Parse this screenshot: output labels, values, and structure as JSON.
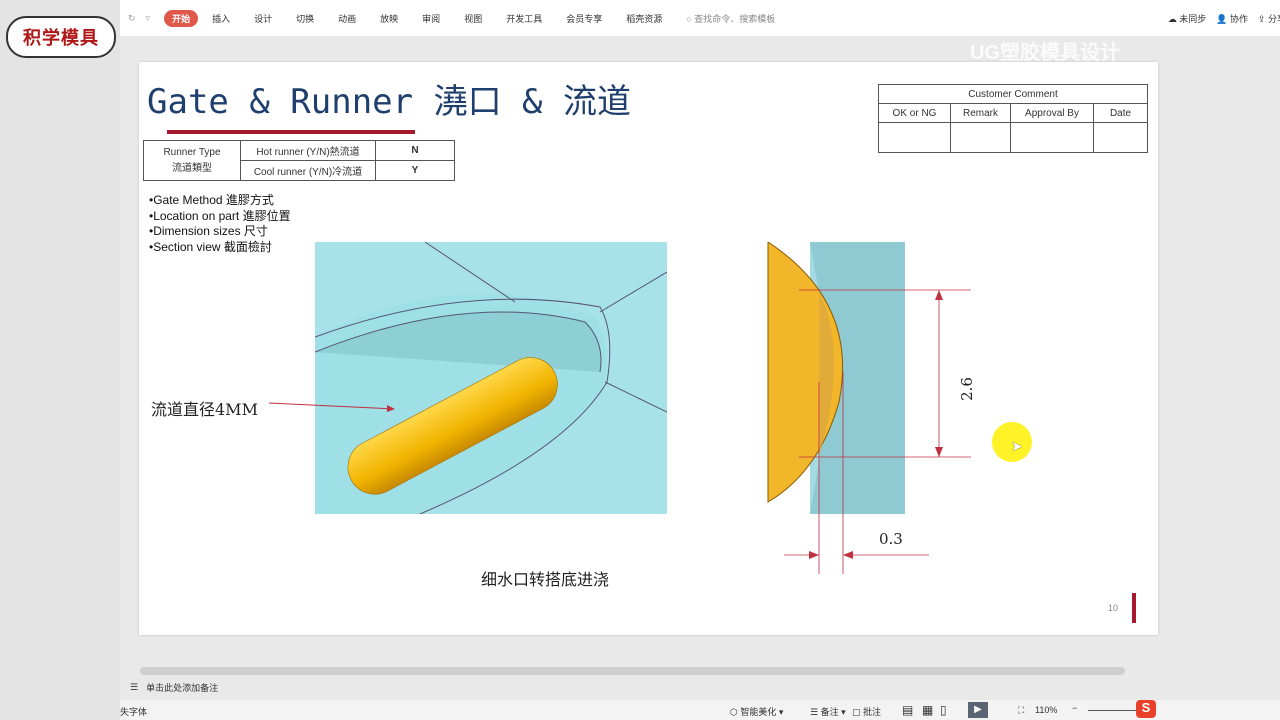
{
  "toolbar": {
    "tabs": [
      "开始",
      "插入",
      "设计",
      "切换",
      "动画",
      "放映",
      "审阅",
      "视图",
      "开发工具",
      "会员专享",
      "稻壳资源"
    ],
    "search_placeholder": "查找命令、搜索模板",
    "sync": "未同步",
    "collab": "协作",
    "share": "分享"
  },
  "logo": "积学模具",
  "watermark": "UG塑胶模具设计",
  "slide": {
    "title": "Gate & Runner 澆口 & 流道",
    "runner_table": {
      "label_en": "Runner Type",
      "label_cn": "流道類型",
      "rows": [
        {
          "name": "Hot runner (Y/N)熱流道",
          "value": "N"
        },
        {
          "name": "Cool runner (Y/N)冷流道",
          "value": "Y"
        }
      ]
    },
    "customer_table": {
      "title": "Customer Comment",
      "headers": [
        "OK or NG",
        "Remark",
        "Approval  By",
        "Date"
      ]
    },
    "bullets": [
      "•Gate Method 進膠方式",
      "•Location on part 進膠位置",
      "•Dimension sizes 尺寸",
      "•Section view 截面檢討"
    ],
    "runner_label": "流道直径4MM",
    "caption": "细水口转搭底进浇",
    "dim_height": "2.6",
    "dim_width": "0.3",
    "page_number": "10"
  },
  "notes_placeholder": "单击此处添加备注",
  "status": {
    "missing_font": "失字体",
    "beautify": "智能美化",
    "notes": "备注",
    "comment": "批注",
    "zoom": "110%"
  }
}
